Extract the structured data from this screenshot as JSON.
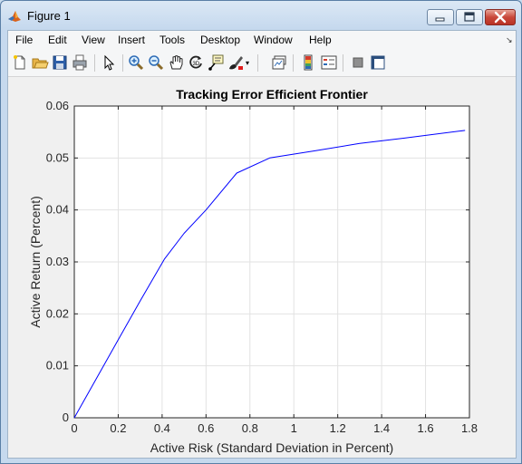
{
  "window": {
    "title": "Figure 1",
    "icon": "matlab-icon",
    "controls": [
      "minimize-icon",
      "maximize-icon",
      "close-icon"
    ]
  },
  "menubar": {
    "items": [
      {
        "label": "File"
      },
      {
        "label": "Edit"
      },
      {
        "label": "View"
      },
      {
        "label": "Insert"
      },
      {
        "label": "Tools"
      },
      {
        "label": "Desktop"
      },
      {
        "label": "Window"
      },
      {
        "label": "Help"
      }
    ],
    "overflow_icon": "dock-arrow-icon"
  },
  "toolbar": {
    "buttons": [
      {
        "icon": "new-figure-icon"
      },
      {
        "icon": "open-file-icon"
      },
      {
        "icon": "save-icon"
      },
      {
        "icon": "print-icon"
      },
      {
        "icon": "edit-plot-arrow-icon"
      },
      {
        "icon": "zoom-in-icon"
      },
      {
        "icon": "zoom-out-icon"
      },
      {
        "icon": "pan-hand-icon"
      },
      {
        "icon": "rotate-3d-icon"
      },
      {
        "icon": "data-cursor-icon"
      },
      {
        "icon": "brush-icon"
      },
      {
        "icon": "link-plot-icon"
      },
      {
        "icon": "colorbar-icon"
      },
      {
        "icon": "legend-icon"
      },
      {
        "icon": "hide-plot-tools-icon"
      },
      {
        "icon": "show-plot-tools-icon"
      }
    ]
  },
  "colors": {
    "line": "#0000ff",
    "grid": "#e2e2e2",
    "axes_bg": "#ffffff",
    "figure_bg": "#f0f0f0"
  },
  "chart_data": {
    "type": "line",
    "title": "Tracking Error Efficient Frontier",
    "xlabel": "Active Risk (Standard Deviation in Percent)",
    "ylabel": "Active Return (Percent)",
    "xlim": [
      0,
      1.8
    ],
    "ylim": [
      0,
      0.06
    ],
    "xticks": [
      "0",
      "0.2",
      "0.4",
      "0.6",
      "0.8",
      "1",
      "1.2",
      "1.4",
      "1.6",
      "1.8"
    ],
    "yticks": [
      "0",
      "0.01",
      "0.02",
      "0.03",
      "0.04",
      "0.05",
      "0.06"
    ],
    "grid": true,
    "series": [
      {
        "x": [
          0,
          0.1,
          0.2,
          0.3,
          0.41,
          0.5,
          0.6,
          0.74,
          0.89,
          1.1,
          1.3,
          1.5,
          1.78
        ],
        "y": [
          0,
          0.0075,
          0.015,
          0.0225,
          0.0305,
          0.0355,
          0.04,
          0.0471,
          0.05,
          0.0514,
          0.0528,
          0.0538,
          0.0553
        ]
      }
    ]
  }
}
